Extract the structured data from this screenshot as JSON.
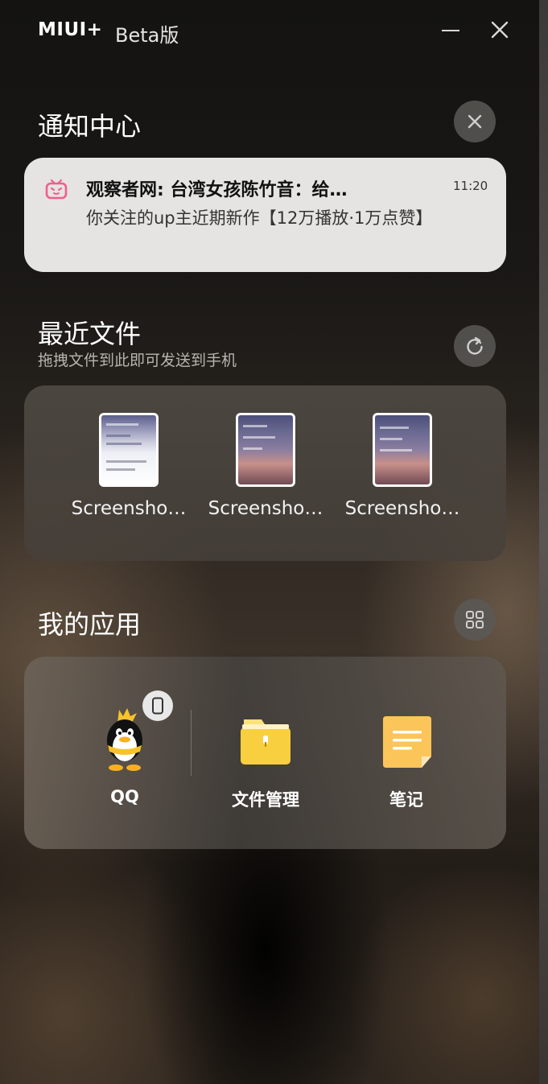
{
  "titlebar": {
    "brand": "MIUI+",
    "beta": "Beta版"
  },
  "notification_center": {
    "title": "通知中心",
    "notification": {
      "app_icon": "bilibili-icon",
      "title": "观察者网: 台湾女孩陈竹音：给…",
      "time": "11:20",
      "body": "你关注的up主近期新作【12万播放·1万点赞】"
    }
  },
  "recent_files": {
    "title": "最近文件",
    "subtitle": "拖拽文件到此即可发送到手机",
    "files": [
      {
        "name": "Screensho…"
      },
      {
        "name": "Screensho…"
      },
      {
        "name": "Screensho…"
      }
    ]
  },
  "my_apps": {
    "title": "我的应用",
    "apps": [
      {
        "name": "QQ",
        "icon": "qq-penguin-icon"
      },
      {
        "name": "文件管理",
        "icon": "folder-icon"
      },
      {
        "name": "笔记",
        "icon": "notes-icon"
      }
    ]
  },
  "colors": {
    "accent_yellow": "#f8cf3f",
    "notif_bg": "#e5e4e3",
    "bilibili_pink": "#f25d8e"
  }
}
